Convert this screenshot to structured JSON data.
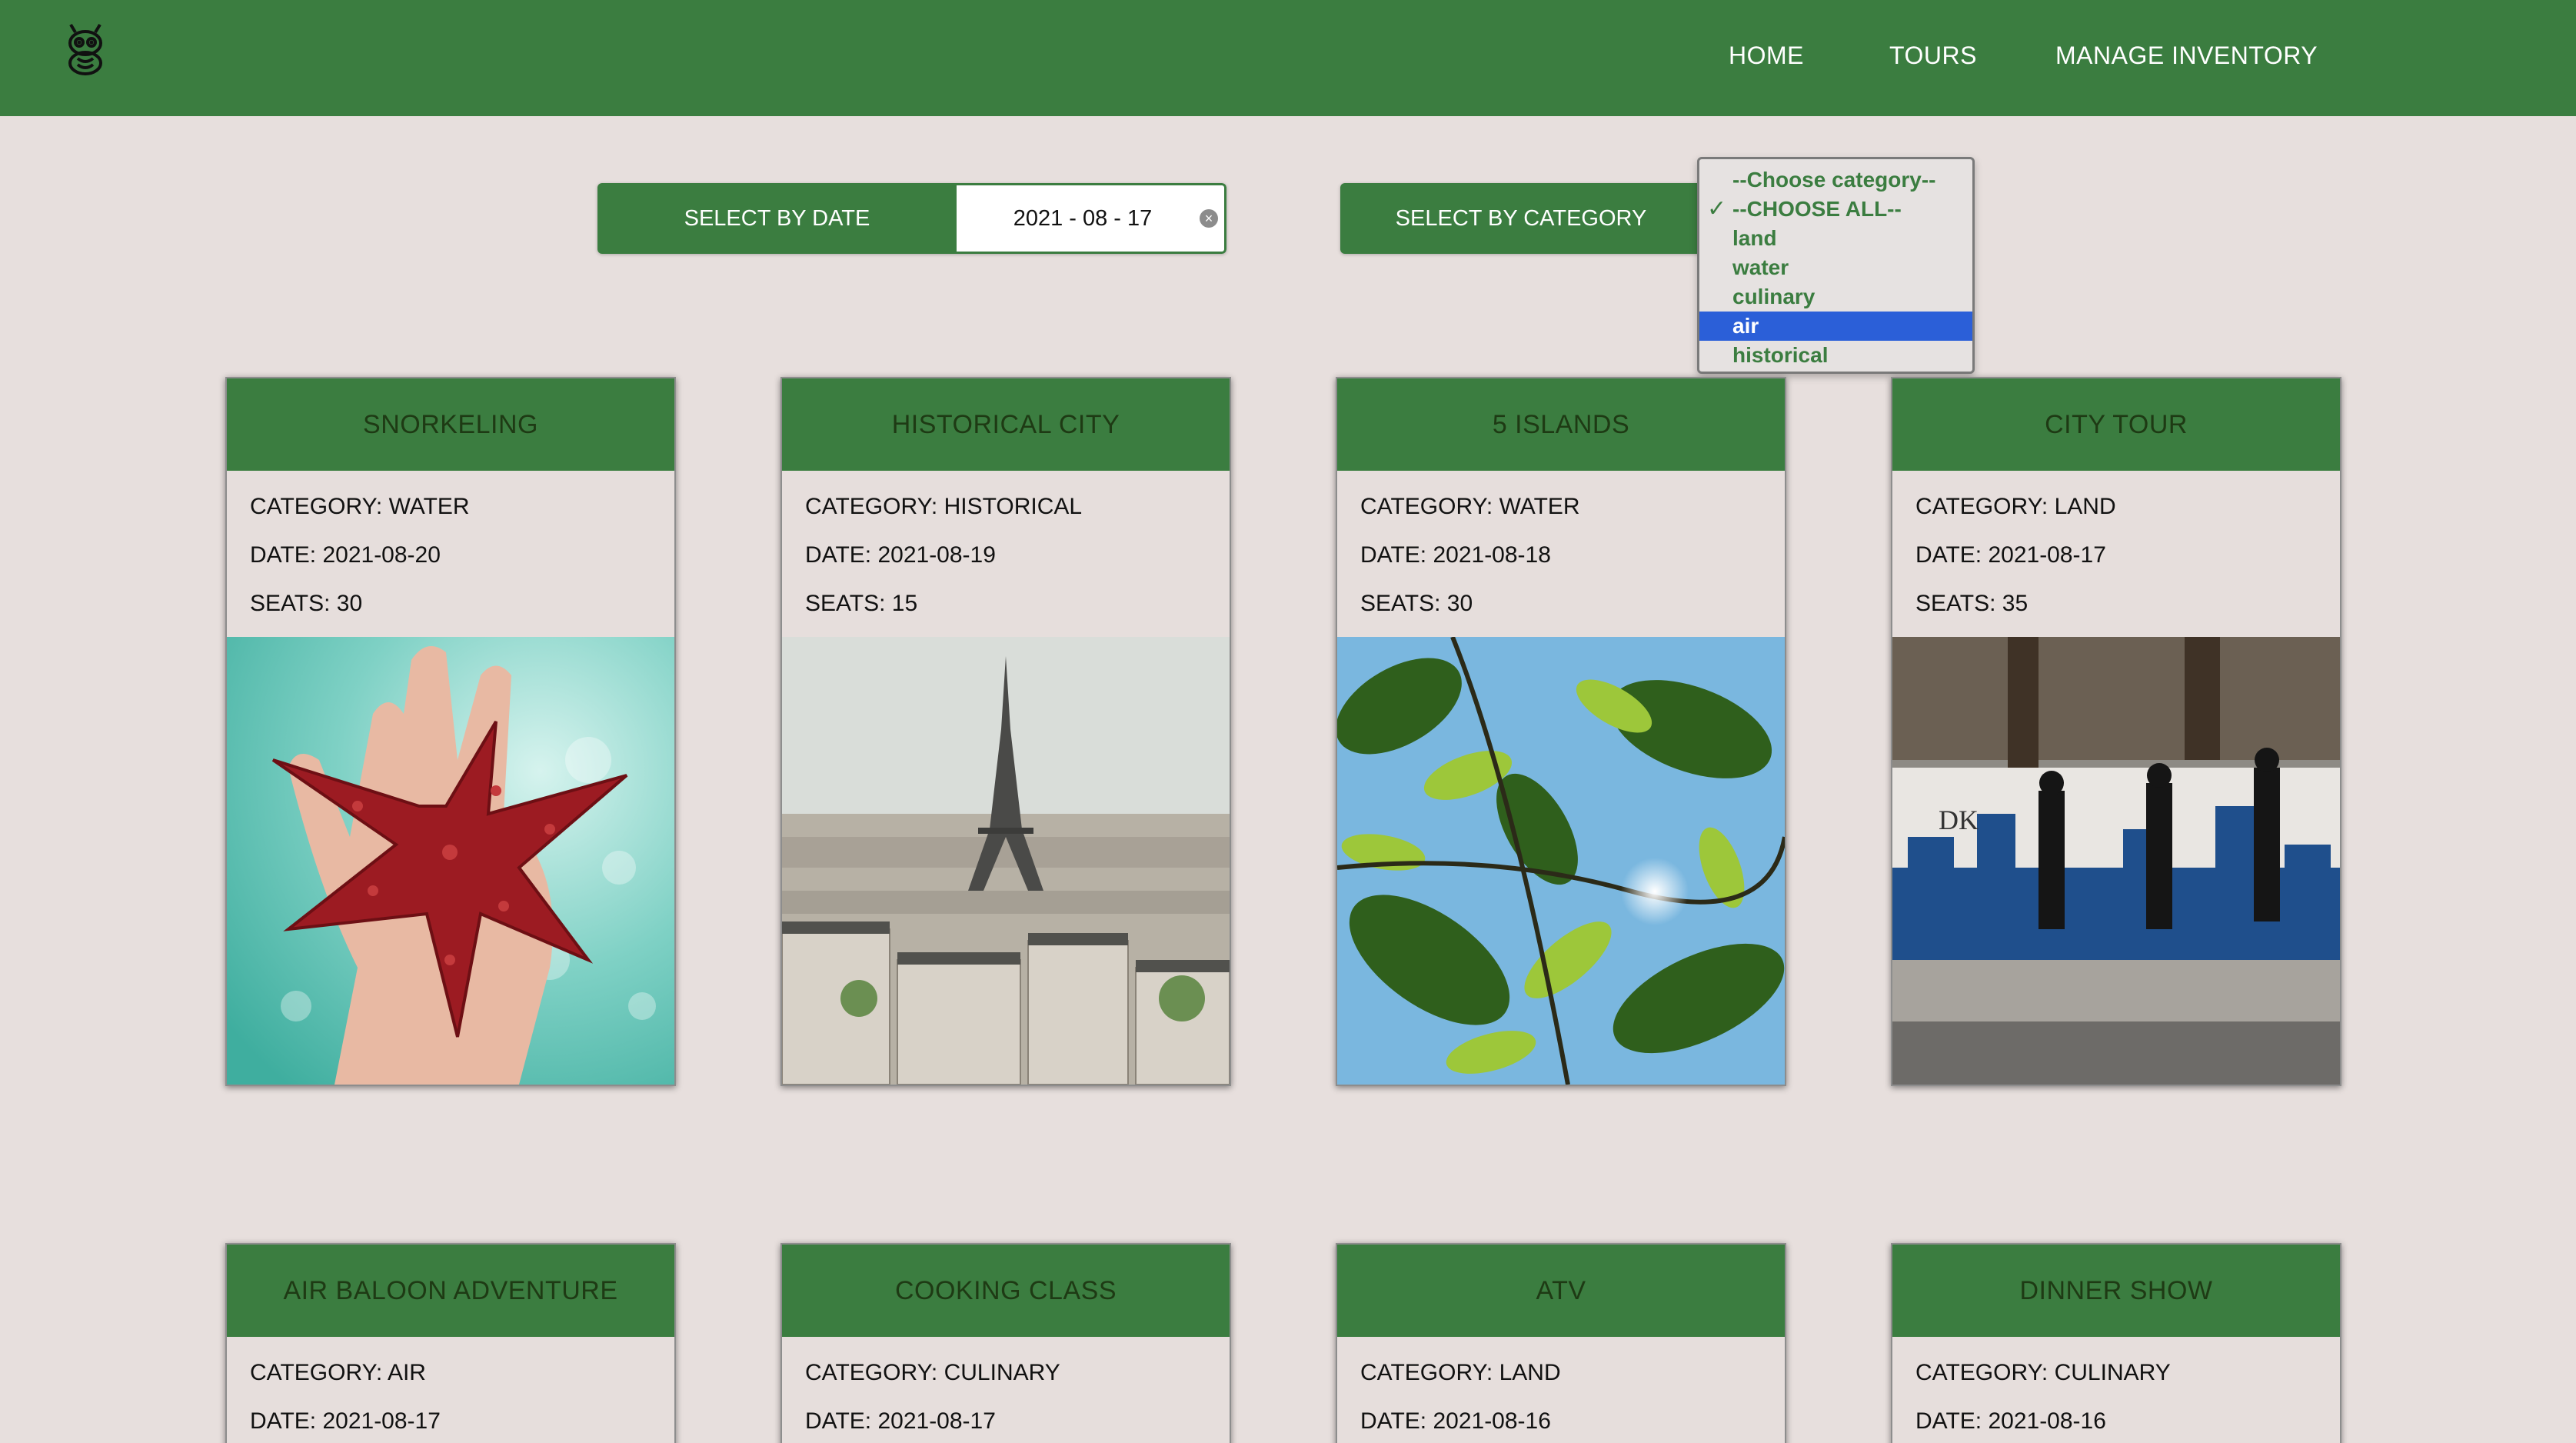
{
  "navbar": {
    "logo": "owl-logo-icon",
    "links": [
      "HOME",
      "TOURS",
      "MANAGE INVENTORY"
    ]
  },
  "filters": {
    "date_label": "SELECT BY DATE",
    "date_value": "2021 - 08 - 17",
    "category_label": "SELECT BY CATEGORY",
    "category_options": [
      "--Choose category--",
      "--CHOOSE ALL--",
      "land",
      "water",
      "culinary",
      "air",
      "historical"
    ],
    "category_checked": "--CHOOSE ALL--",
    "category_highlighted": "air"
  },
  "tours": [
    {
      "title": "SNORKELING",
      "category": "CATEGORY: WATER",
      "date": "DATE: 2021-08-20",
      "seats": "SEATS: 30",
      "image": "starfish-photo"
    },
    {
      "title": "HISTORICAL CITY",
      "category": "CATEGORY: HISTORICAL",
      "date": "DATE: 2021-08-19",
      "seats": "SEATS: 15",
      "image": "eiffel-tower-photo"
    },
    {
      "title": "5 ISLANDS",
      "category": "CATEGORY: WATER",
      "date": "DATE: 2021-08-18",
      "seats": "SEATS: 30",
      "image": "leaves-sunlight-photo"
    },
    {
      "title": "CITY TOUR",
      "category": "CATEGORY: LAND",
      "date": "DATE: 2021-08-17",
      "seats": "SEATS: 35",
      "image": "street-mural-photo"
    },
    {
      "title": "AIR BALOON ADVENTURE",
      "category": "CATEGORY: AIR",
      "date": "DATE: 2021-08-17"
    },
    {
      "title": "COOKING CLASS",
      "category": "CATEGORY: CULINARY",
      "date": "DATE: 2021-08-17"
    },
    {
      "title": "ATV",
      "category": "CATEGORY: LAND",
      "date": "DATE: 2021-08-16"
    },
    {
      "title": "DINNER SHOW",
      "category": "CATEGORY: CULINARY",
      "date": "DATE: 2021-08-16"
    }
  ],
  "colors": {
    "brand_green": "#3b7d40",
    "page_background": "#e7dfdd",
    "selected_option": "#2b5fd8"
  }
}
